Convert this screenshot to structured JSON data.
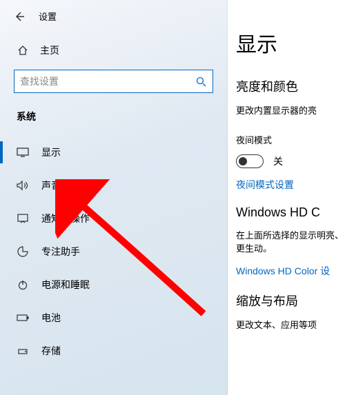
{
  "app": {
    "title": "设置"
  },
  "sidebar": {
    "home": "主页",
    "search_placeholder": "查找设置",
    "category": "系统",
    "items": [
      {
        "label": "显示"
      },
      {
        "label": "声音"
      },
      {
        "label": "通知和操作"
      },
      {
        "label": "专注助手"
      },
      {
        "label": "电源和睡眠"
      },
      {
        "label": "电池"
      },
      {
        "label": "存储"
      }
    ]
  },
  "main": {
    "heading": "显示",
    "section1_title": "亮度和颜色",
    "brightness_text": "更改内置显示器的亮",
    "night_mode_label": "夜间模式",
    "night_mode_state": "关",
    "night_mode_settings": "夜间模式设置",
    "hd_title": "Windows HD C",
    "hd_text": "在上面所选择的显示明亮、更生动。",
    "hd_link": "Windows HD Color 设",
    "scale_title": "缩放与布局",
    "scale_text": "更改文本、应用等项"
  }
}
